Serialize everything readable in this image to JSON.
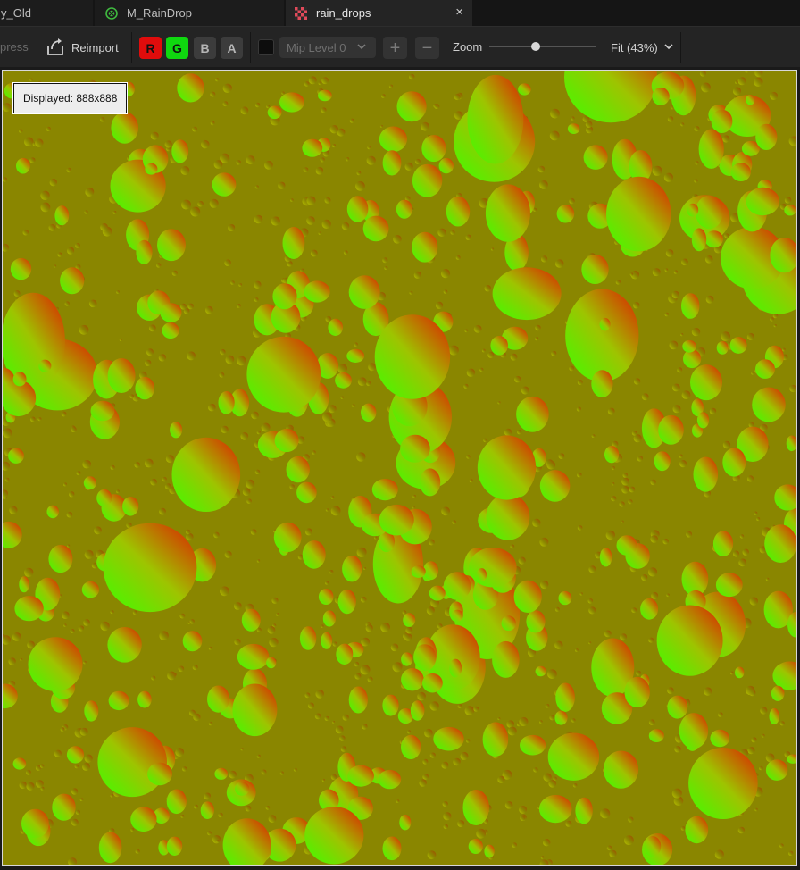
{
  "tabs": [
    {
      "label": "y_Old",
      "icon": "none",
      "active": false
    },
    {
      "label": "M_RainDrop",
      "icon": "material-sphere-icon",
      "active": false
    },
    {
      "label": "rain_drops",
      "icon": "texture-checker-icon",
      "active": true,
      "close": "×"
    }
  ],
  "toolbar": {
    "compress_label": "press",
    "reimport_label": "Reimport",
    "channels": {
      "r": "R",
      "g": "G",
      "b": "B",
      "a": "A"
    },
    "mip_label": "Mip Level 0",
    "plus": "+",
    "minus": "−",
    "zoom_label": "Zoom",
    "zoom_level": 0.43,
    "fit_label": "Fit (43%)"
  },
  "viewport": {
    "displayed_label": "Displayed: 888x888"
  },
  "colors": {
    "background": "#8a8600",
    "channel_r": "#e00c0c",
    "channel_g": "#0fd80f"
  }
}
